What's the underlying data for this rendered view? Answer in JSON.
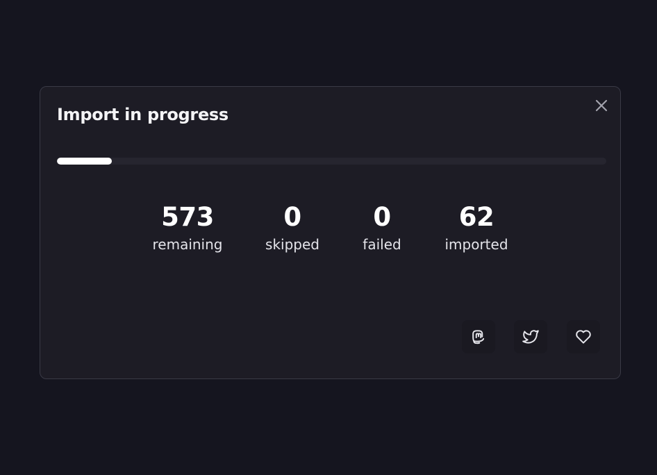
{
  "modal": {
    "title": "Import in progress",
    "close_icon": "close-icon",
    "progress": {
      "fraction": 0.1,
      "color": "#ffffff"
    },
    "stats": [
      {
        "value": "573",
        "label": "remaining"
      },
      {
        "value": "0",
        "label": "skipped"
      },
      {
        "value": "0",
        "label": "failed"
      },
      {
        "value": "62",
        "label": "imported"
      }
    ],
    "share": [
      {
        "icon": "mastodon-icon",
        "action": "share-mastodon"
      },
      {
        "icon": "twitter-icon",
        "action": "share-twitter"
      },
      {
        "icon": "heart-icon",
        "action": "donate"
      }
    ]
  },
  "colors": {
    "background": "#15151f",
    "modal": "#1d1c25",
    "border": "#3a3a46",
    "track": "#26252f"
  }
}
